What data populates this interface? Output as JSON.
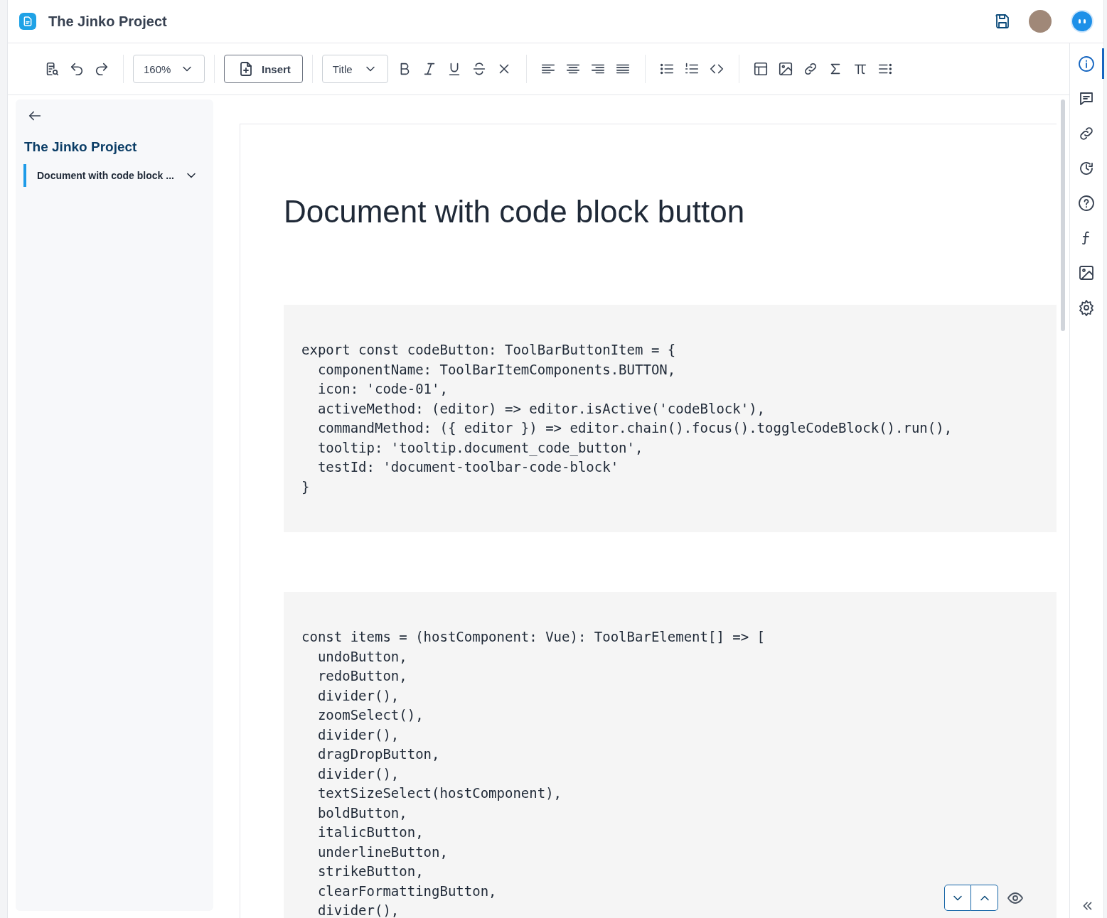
{
  "header": {
    "title": "The Jinko Project"
  },
  "toolbar": {
    "zoom": "160%",
    "insert": "Insert",
    "text_style": "Title"
  },
  "sidebar": {
    "project_title": "The Jinko Project",
    "items": [
      {
        "label": "Document with code block ...",
        "selected": true
      }
    ]
  },
  "document": {
    "title": "Document with code block button",
    "code_blocks": [
      {
        "lines": [
          "export const codeButton: ToolBarButtonItem = {",
          "  componentName: ToolBarItemComponents.BUTTON,",
          "  icon: 'code-01',",
          "  activeMethod: (editor) => editor.isActive('codeBlock'),",
          "  commandMethod: ({ editor }) => editor.chain().focus().toggleCodeBlock().run(),",
          "  tooltip: 'tooltip.document_code_button',",
          "  testId: 'document-toolbar-code-block'",
          "}"
        ]
      },
      {
        "lines": [
          "const items = (hostComponent: Vue): ToolBarElement[] => [",
          "  undoButton,",
          "  redoButton,",
          "  divider(),",
          "  zoomSelect(),",
          "  divider(),",
          "  dragDropButton,",
          "  divider(),",
          "  textSizeSelect(hostComponent),",
          "  boldButton,",
          "  italicButton,",
          "  underlineButton,",
          "  strikeButton,",
          "  clearFormattingButton,",
          "  divider(),"
        ]
      }
    ]
  },
  "right_rail": [
    {
      "selected": true
    },
    {
      "selected": false
    },
    {
      "selected": false
    },
    {
      "selected": false
    },
    {
      "selected": false
    },
    {
      "selected": false
    },
    {
      "selected": false
    },
    {
      "selected": false
    }
  ]
}
